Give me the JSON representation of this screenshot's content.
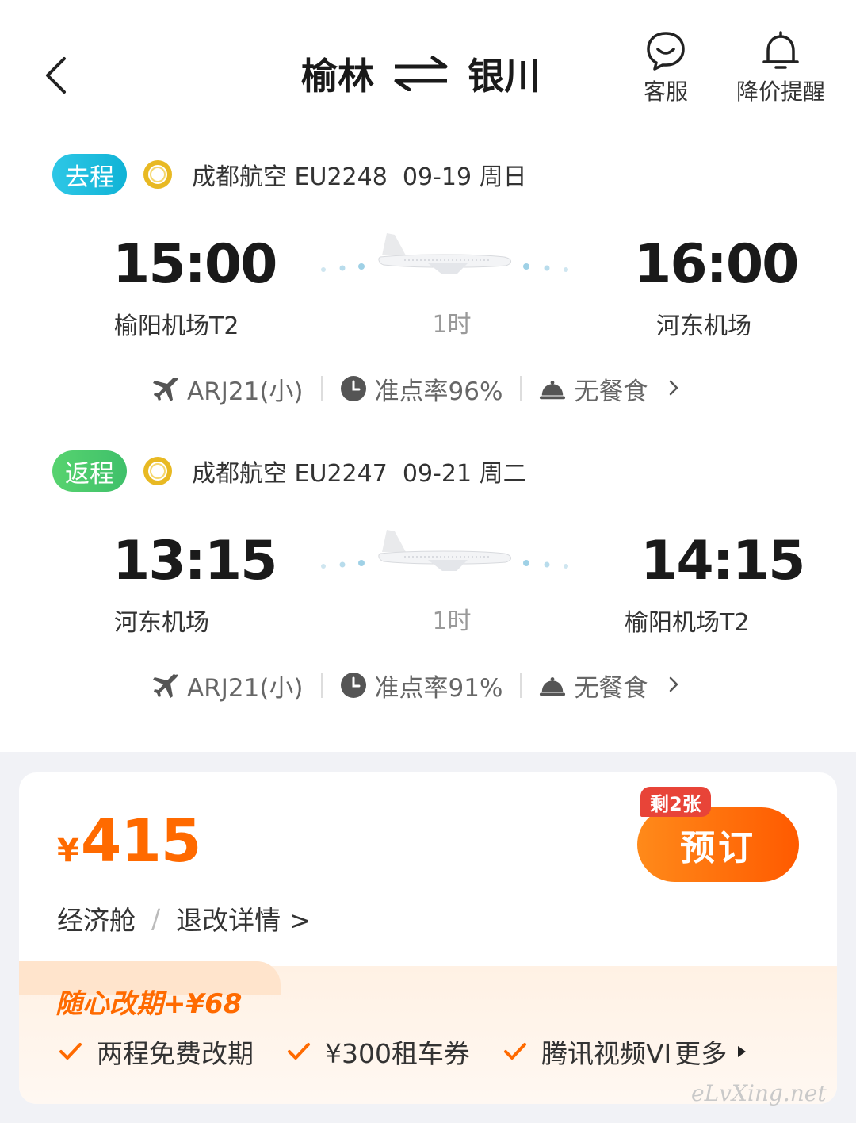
{
  "header": {
    "origin": "榆林",
    "destination": "银川",
    "service_label": "客服",
    "price_alert_label": "降价提醒"
  },
  "outbound": {
    "badge": "去程",
    "info": "成都航空 EU2248  09-19 周日",
    "dep_time": "15:00",
    "dep_airport": "榆阳机场T2",
    "arr_time": "16:00",
    "arr_airport": "河东机场",
    "duration": "1时",
    "aircraft": "ARJ21(小)",
    "on_time": "准点率96%",
    "meal": "无餐食"
  },
  "return": {
    "badge": "返程",
    "info": "成都航空 EU2247  09-21 周二",
    "dep_time": "13:15",
    "dep_airport": "河东机场",
    "arr_time": "14:15",
    "arr_airport": "榆阳机场T2",
    "duration": "1时",
    "aircraft": "ARJ21(小)",
    "on_time": "准点率91%",
    "meal": "无餐食"
  },
  "fare": {
    "currency": "¥",
    "price": "415",
    "cabin": "经济舱",
    "slash": "/",
    "refund_details": "退改详情 >",
    "tickets_left": "剩2张",
    "book_label": "预订"
  },
  "bundle": {
    "title": "随心改期+¥68",
    "items": [
      "两程免费改期",
      "¥300租车券",
      "腾讯视频VI"
    ],
    "more": "更多"
  },
  "watermark": "eLvXing.net",
  "colors": {
    "accent": "#ff6a00",
    "outbound_badge": "#1fbde0",
    "return_badge": "#4cc96c",
    "tickets_badge": "#e84438"
  }
}
